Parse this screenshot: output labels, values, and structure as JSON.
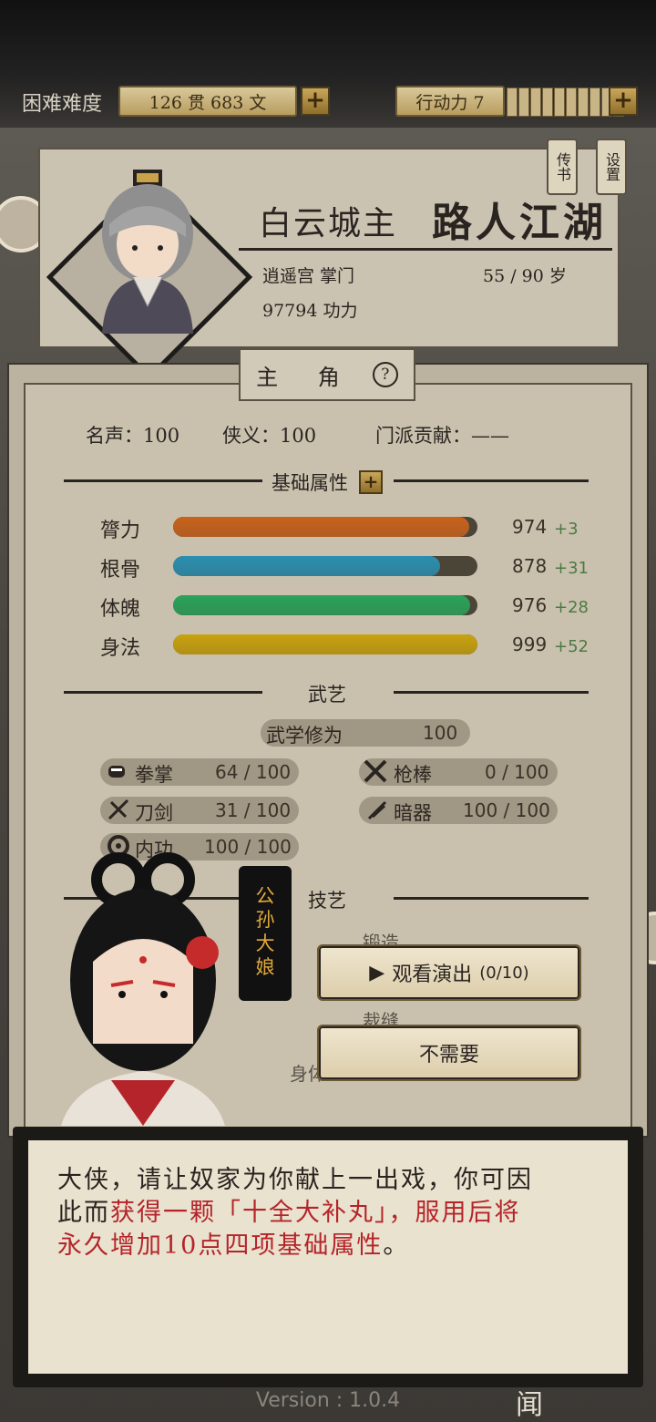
{
  "topbar": {
    "difficulty": "困难难度",
    "money": "126 贯  683 文",
    "action": "行动力 7"
  },
  "side_buttons": [
    "传书",
    "设置"
  ],
  "profile": {
    "title": "白云城主",
    "nickname": "路人江湖",
    "sect": "逍遥宫 掌门",
    "age": "55 / 90 岁",
    "power": "97794 功力"
  },
  "panel_tab": {
    "label": "主 角",
    "help": "?"
  },
  "reputation": {
    "fame": "名声：100",
    "chivalry": "侠义：100",
    "contribution": "门派贡献：——"
  },
  "basic_attrs": {
    "header": "基础属性",
    "items": [
      {
        "label": "膂力",
        "value": "974",
        "bonus": "+3",
        "fill": 0.974,
        "color": "#c8621c"
      },
      {
        "label": "根骨",
        "value": "878",
        "bonus": "+31",
        "fill": 0.878,
        "color": "#2a8fb0"
      },
      {
        "label": "体魄",
        "value": "976",
        "bonus": "+28",
        "fill": 0.976,
        "color": "#2aa35a"
      },
      {
        "label": "身法",
        "value": "999",
        "bonus": "+52",
        "fill": 0.999,
        "color": "#c9a20f"
      }
    ]
  },
  "martial": {
    "header": "武艺",
    "cultivation_label": "武学修为",
    "cultivation_value": "100",
    "items": [
      {
        "label": "拳掌",
        "value": "64 / 100",
        "icon": "fist-icon"
      },
      {
        "label": "枪棒",
        "value": "0 / 100",
        "icon": "spear-icon"
      },
      {
        "label": "刀剑",
        "value": "31 / 100",
        "icon": "sword-icon"
      },
      {
        "label": "暗器",
        "value": "100 / 100",
        "icon": "dart-icon"
      },
      {
        "label": "内功",
        "value": "100 / 100",
        "icon": "inner-energy-icon"
      }
    ]
  },
  "skills": {
    "header": "技艺",
    "forge": "锻造",
    "tailor": "裁缝",
    "body": "身体"
  },
  "npc": {
    "name": "公孙大娘"
  },
  "choices": {
    "watch": "观看演出",
    "watch_count": "(0/10)",
    "decline": "不需要"
  },
  "dialog": {
    "line1": "大侠，请让奴家为你献上一出戏，你可因",
    "line2_a": "此而",
    "line2_b": "获得一颗「十全大补丸」，服用后将",
    "line3_a": "永久增加10点四项基础属性",
    "line3_b": "。"
  },
  "footer": {
    "version": "Version : 1.0.4",
    "corner": "闻"
  }
}
